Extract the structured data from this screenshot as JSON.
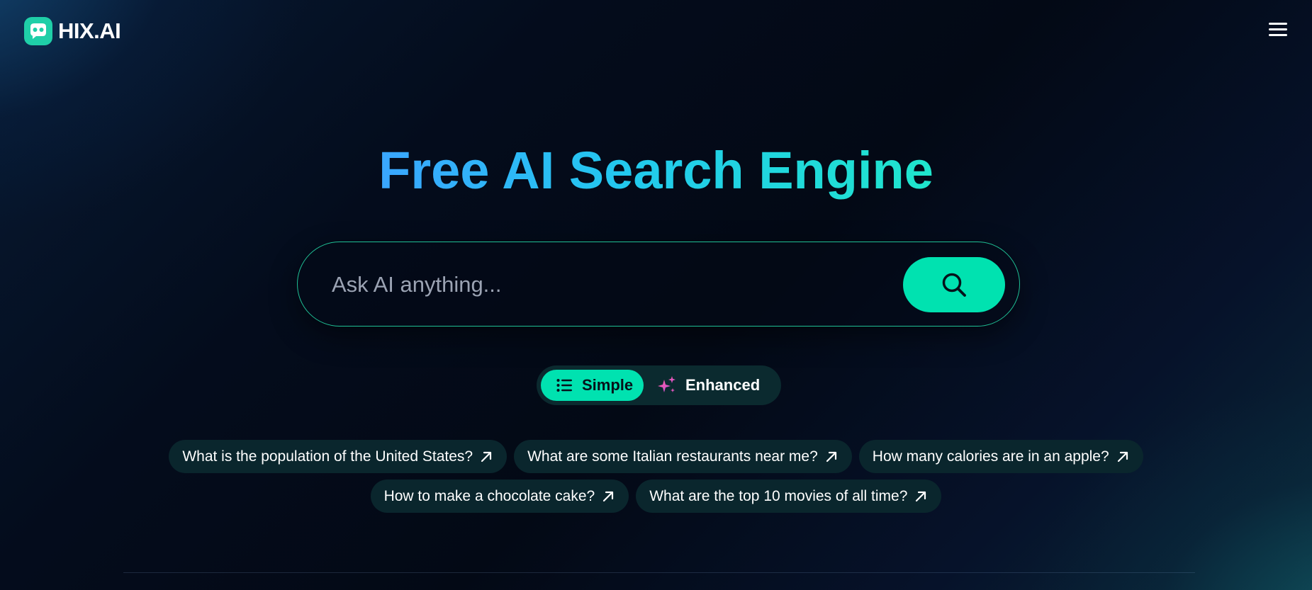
{
  "header": {
    "logo_text": "HIX.AI",
    "logo_icon": "robot-face-icon",
    "menu_icon": "hamburger-menu-icon"
  },
  "hero": {
    "title": "Free AI Search Engine"
  },
  "search": {
    "placeholder": "Ask AI anything...",
    "value": "",
    "button_icon": "search-icon"
  },
  "modes": {
    "selected": "Simple",
    "options": [
      {
        "label": "Simple",
        "icon": "list-icon"
      },
      {
        "label": "Enhanced",
        "icon": "sparkles-icon"
      }
    ]
  },
  "suggestions": [
    "What is the population of the United States?",
    "What are some Italian restaurants near me?",
    "How many calories are in an apple?",
    "How to make a chocolate cake?",
    "What are the top 10 movies of all time?"
  ],
  "colors": {
    "accent": "#00e2b0",
    "title_gradient_start": "#3aa6ff",
    "title_gradient_end": "#1fe6cc",
    "background": "#040c1c",
    "chip_background": "#0a262d"
  }
}
